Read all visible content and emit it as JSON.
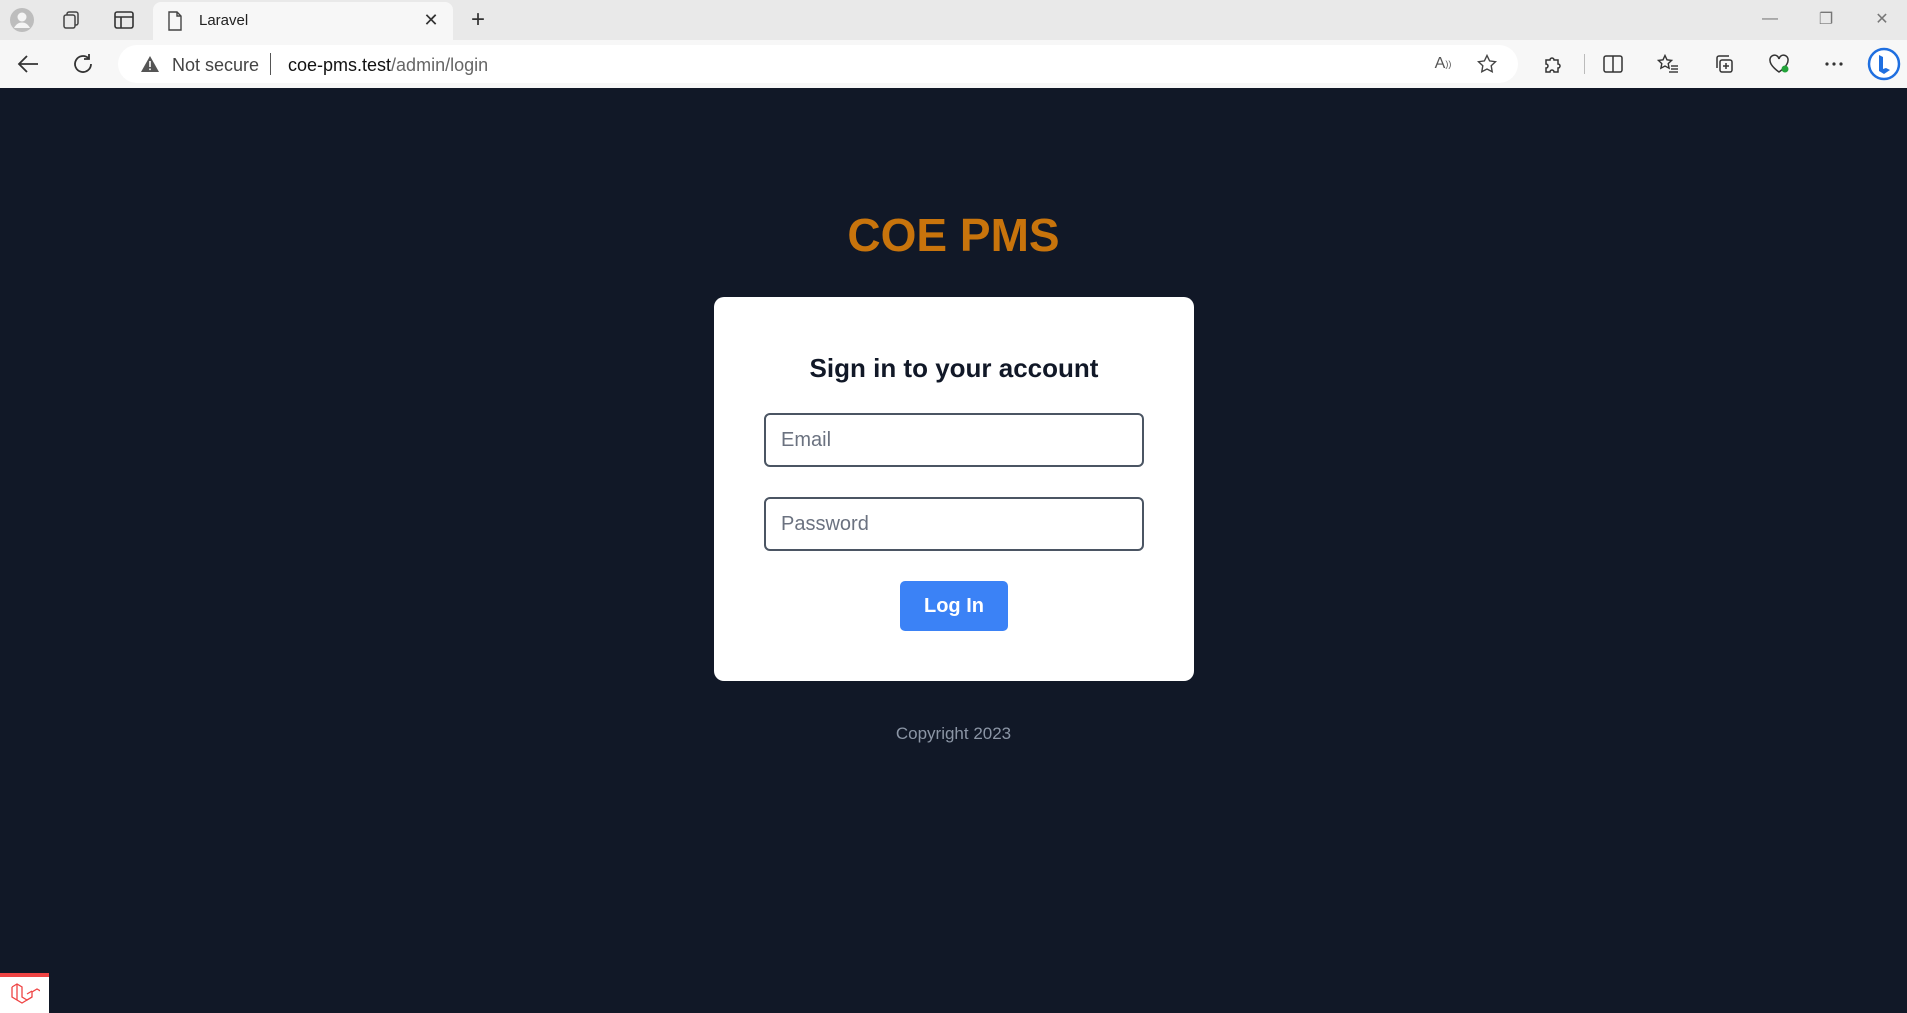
{
  "browser": {
    "tab_title": "Laravel",
    "address": {
      "security_label": "Not secure",
      "url_host": "coe-pms.test",
      "url_path": "/admin/login"
    },
    "icons": {
      "profile": "profile-icon",
      "workspaces": "workspaces-icon",
      "tab_actions": "vertical-tabs-icon",
      "page": "page-icon",
      "close": "close-icon",
      "new_tab": "plus-icon",
      "back": "back-arrow-icon",
      "refresh": "refresh-icon",
      "warning": "warning-icon",
      "read_aloud": "read-aloud-icon",
      "favorite": "star-icon",
      "extensions": "puzzle-icon",
      "split": "split-screen-icon",
      "favorites": "favorites-icon",
      "collections": "collections-icon",
      "health": "browser-essentials-icon",
      "more": "more-icon",
      "copilot": "bing-icon"
    }
  },
  "page": {
    "app_title": "COE PMS",
    "login": {
      "heading": "Sign in to your account",
      "email_placeholder": "Email",
      "password_placeholder": "Password",
      "submit_label": "Log In"
    },
    "footer": "Copyright 2023"
  },
  "colors": {
    "background": "#111827",
    "title": "#c8740c",
    "button": "#3b82f6",
    "card": "#ffffff"
  }
}
